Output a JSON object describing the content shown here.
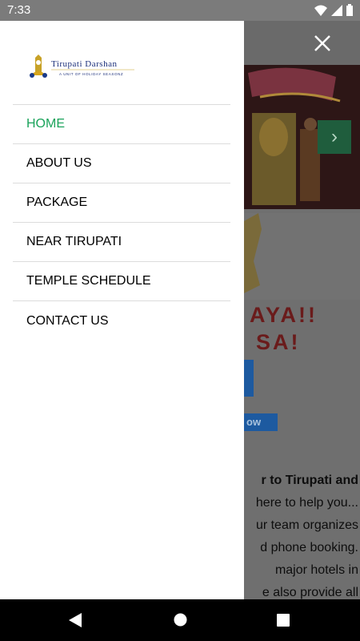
{
  "status": {
    "time": "7:33"
  },
  "drawer": {
    "logo": {
      "title": "Tirupati Darshan",
      "subtitle": "A UNIT OF HOLIDAY SEASONZ"
    },
    "items": [
      {
        "label": "HOME",
        "active": true
      },
      {
        "label": "ABOUT US",
        "active": false
      },
      {
        "label": "PACKAGE",
        "active": false
      },
      {
        "label": "NEAR TIRUPATI",
        "active": false
      },
      {
        "label": "TEMPLE SCHEDULE",
        "active": false
      },
      {
        "label": "CONTACT US",
        "active": false
      }
    ]
  },
  "background": {
    "slogan_line1": "AYA!!",
    "slogan_line2": "SA!",
    "button_text": "ow",
    "text_lines": [
      "r to Tirupati and",
      "here to help you...",
      "ur team organizes",
      "d phone booking.",
      "major hotels in",
      "e also provide all"
    ]
  },
  "colors": {
    "active": "#1aa35a",
    "divider": "#dcdcdc"
  }
}
